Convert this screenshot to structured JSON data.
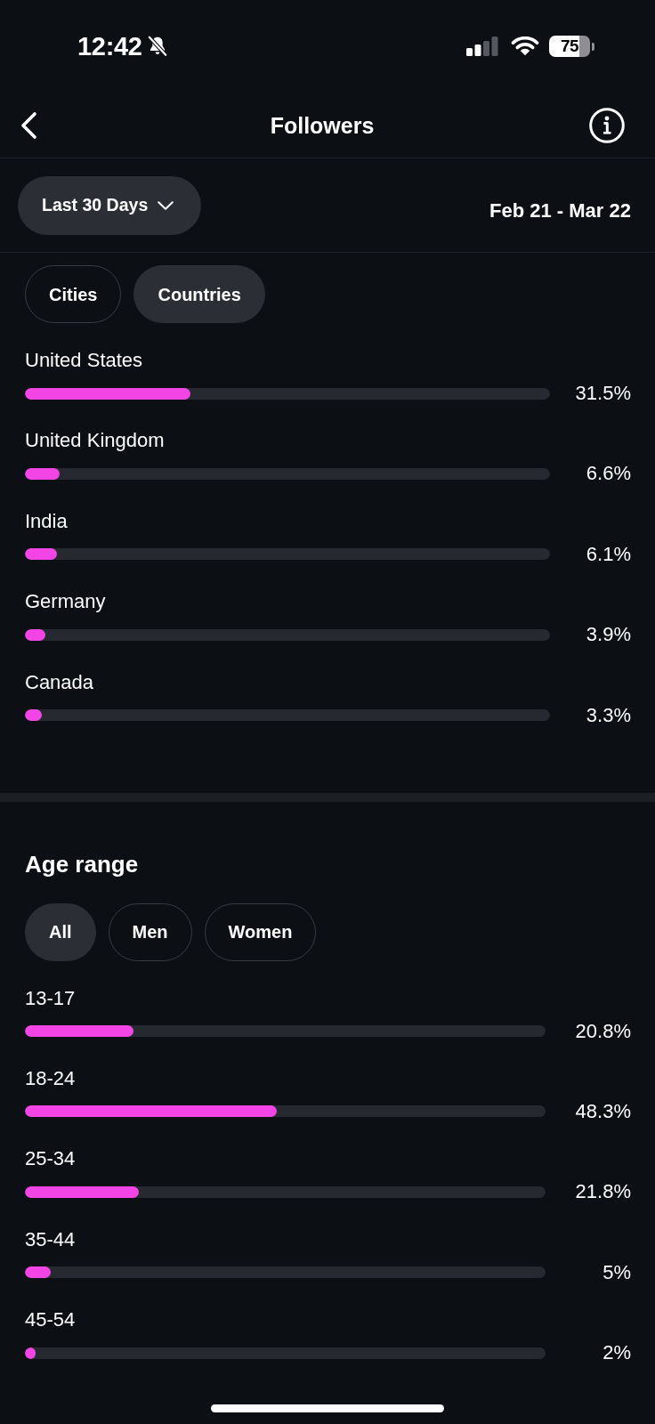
{
  "status_bar": {
    "time": "12:42",
    "battery": "75"
  },
  "header": {
    "title": "Followers"
  },
  "period": {
    "range": "Last 30 Days",
    "dates": "Feb 21 - Mar 22"
  },
  "locations": {
    "tabs": [
      {
        "label": "Cities",
        "selected": false
      },
      {
        "label": "Countries",
        "selected": true
      }
    ],
    "rows": [
      {
        "name": "United States",
        "level": 0.315,
        "reading": "31.5%"
      },
      {
        "name": "United Kingdom",
        "level": 0.066,
        "reading": "6.6%"
      },
      {
        "name": "India",
        "level": 0.061,
        "reading": "6.1%"
      },
      {
        "name": "Germany",
        "level": 0.039,
        "reading": "3.9%"
      },
      {
        "name": "Canada",
        "level": 0.033,
        "reading": "3.3%"
      }
    ]
  },
  "age_range": {
    "title": "Age range",
    "tabs": [
      {
        "label": "All",
        "selected": true
      },
      {
        "label": "Men",
        "selected": false
      },
      {
        "label": "Women",
        "selected": false
      }
    ],
    "rows": [
      {
        "name": "13-17",
        "level": 0.208,
        "reading": "20.8%"
      },
      {
        "name": "18-24",
        "level": 0.483,
        "reading": "48.3%"
      },
      {
        "name": "25-34",
        "level": 0.218,
        "reading": "21.8%"
      },
      {
        "name": "35-44",
        "level": 0.05,
        "reading": "5%"
      },
      {
        "name": "45-54",
        "level": 0.02,
        "reading": "2%"
      }
    ]
  }
}
